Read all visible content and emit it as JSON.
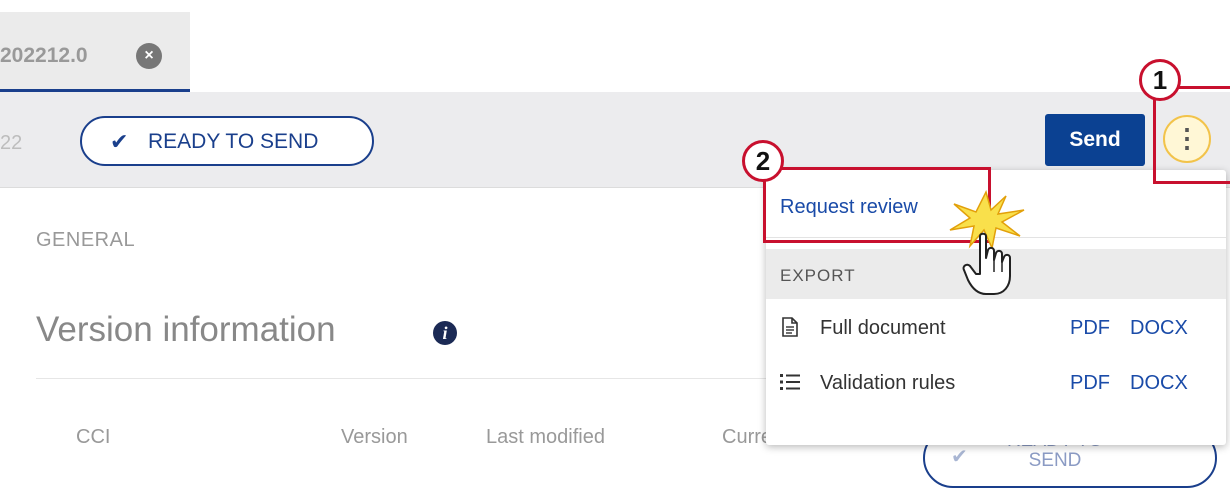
{
  "tabbar": {
    "tab_label": "202212.0",
    "close_glyph": "×"
  },
  "toolbar": {
    "number_fragment": "22",
    "status": {
      "check": "✔",
      "label": "READY TO SEND"
    },
    "send_label": "Send",
    "more_glyph": "⋮"
  },
  "section": {
    "label": "GENERAL",
    "title": "Version information",
    "info_glyph": "i"
  },
  "table": {
    "headers": [
      "CCI",
      "Version",
      "Last modified",
      "Current node"
    ],
    "row_status": {
      "check": "✔",
      "label": "READY TO SEND"
    }
  },
  "dropdown": {
    "request_review": "Request review",
    "export_heading": "EXPORT",
    "items": [
      {
        "icon": "document-icon",
        "label": "Full document",
        "pdf": "PDF",
        "docx": "DOCX"
      },
      {
        "icon": "list-icon",
        "label": "Validation rules",
        "pdf": "PDF",
        "docx": "DOCX"
      }
    ]
  },
  "annotations": {
    "marker1": "1",
    "marker2": "2",
    "highlight_color": "#c8102e"
  },
  "colors": {
    "primary": "#0b4192",
    "link": "#1a4ba8",
    "toolbar_bg": "#ececee"
  }
}
